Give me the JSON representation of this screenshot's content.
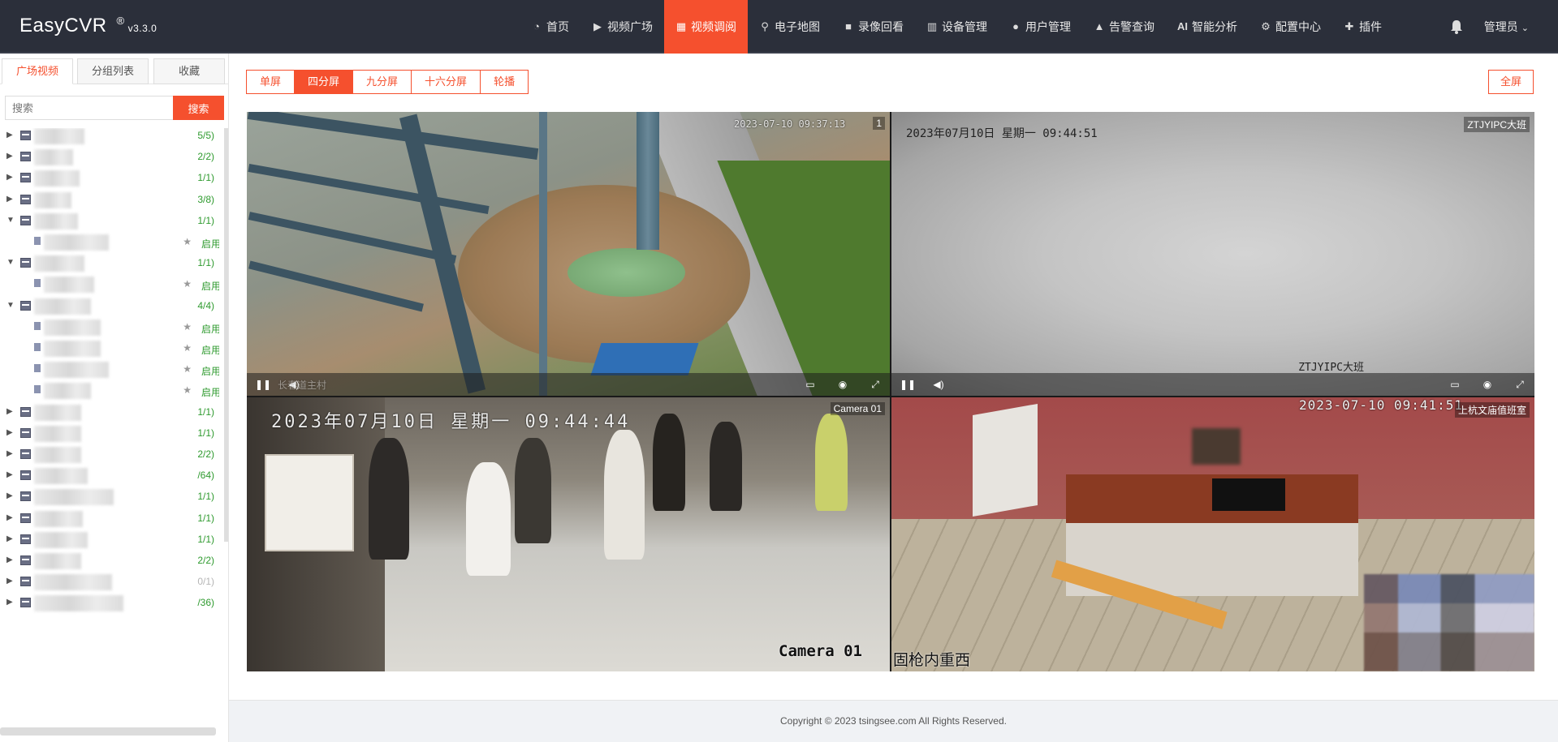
{
  "app": {
    "name": "EasyCVR",
    "reg": "®",
    "version": "v3.3.0"
  },
  "nav": {
    "items": [
      {
        "label": "首页",
        "icon": "dashboard-icon"
      },
      {
        "label": "视频广场",
        "icon": "play-circle-icon"
      },
      {
        "label": "视频调阅",
        "icon": "layout-icon",
        "active": true
      },
      {
        "label": "电子地图",
        "icon": "map-pin-icon"
      },
      {
        "label": "录像回看",
        "icon": "video-icon"
      },
      {
        "label": "设备管理",
        "icon": "columns-icon"
      },
      {
        "label": "用户管理",
        "icon": "user-icon"
      },
      {
        "label": "告警查询",
        "icon": "alarm-icon"
      },
      {
        "label": "智能分析",
        "icon": "ai-icon",
        "icon_text": "AI"
      },
      {
        "label": "配置中心",
        "icon": "gear-icon"
      },
      {
        "label": "插件",
        "icon": "puzzle-icon"
      }
    ],
    "user": "管理员"
  },
  "sidebar": {
    "tabs": [
      "广场视频",
      "分组列表",
      "收藏"
    ],
    "search": {
      "placeholder": "搜索",
      "button": "搜索"
    },
    "tree": [
      {
        "level": 0,
        "expanded": false,
        "count": "5/5)"
      },
      {
        "level": 0,
        "expanded": false,
        "count": "2/2)"
      },
      {
        "level": 0,
        "expanded": false,
        "count": "1/1)"
      },
      {
        "level": 0,
        "expanded": false,
        "count": "3/8)"
      },
      {
        "level": 0,
        "expanded": true,
        "count": "1/1)"
      },
      {
        "level": 1,
        "status": "启用"
      },
      {
        "level": 0,
        "expanded": true,
        "count": "1/1)"
      },
      {
        "level": 1,
        "status": "启用"
      },
      {
        "level": 0,
        "expanded": true,
        "count": "4/4)"
      },
      {
        "level": 1,
        "status": "启用"
      },
      {
        "level": 1,
        "status": "启用"
      },
      {
        "level": 1,
        "status": "启用"
      },
      {
        "level": 1,
        "status": "启用"
      },
      {
        "level": 0,
        "expanded": false,
        "count": "1/1)"
      },
      {
        "level": 0,
        "expanded": false,
        "count": "1/1)"
      },
      {
        "level": 0,
        "expanded": false,
        "count": "2/2)"
      },
      {
        "level": 0,
        "expanded": false,
        "count": "/64)"
      },
      {
        "level": 0,
        "expanded": false,
        "count": "1/1)"
      },
      {
        "level": 0,
        "expanded": false,
        "count": "1/1)"
      },
      {
        "level": 0,
        "expanded": false,
        "count": "1/1)"
      },
      {
        "level": 0,
        "expanded": false,
        "count": "2/2)"
      },
      {
        "level": 0,
        "expanded": false,
        "count": "0/1)",
        "offline": true
      },
      {
        "level": 0,
        "expanded": false,
        "count": "/36)"
      }
    ]
  },
  "toolbar": {
    "splits": [
      "单屏",
      "四分屏",
      "九分屏",
      "十六分屏",
      "轮播"
    ],
    "active_split": "四分屏",
    "fullscreen": "全屏"
  },
  "players": [
    {
      "title": "1",
      "osd_time": "2023-07-10 09:37:13",
      "caption": "长春道主村"
    },
    {
      "title": "ZTJYIPC大班",
      "osd_time": "2023年07月10日  星期一  09:44:51",
      "caption": "ZTJYIPC大班"
    },
    {
      "title": "Camera 01",
      "osd_time": "2023年07月10日  星期一  09:44:44",
      "caption": "Camera  01"
    },
    {
      "title": "上杭文庙值班室",
      "osd_time": "2023-07-10 09:41:51",
      "caption": "固枪内重西"
    }
  ],
  "footer": {
    "copyright": "Copyright © 2023 tsingsee.com All Rights Reserved."
  },
  "colors": {
    "accent": "#f5502e",
    "navbar": "#2b2f3a",
    "online": "#2e9a2e"
  }
}
